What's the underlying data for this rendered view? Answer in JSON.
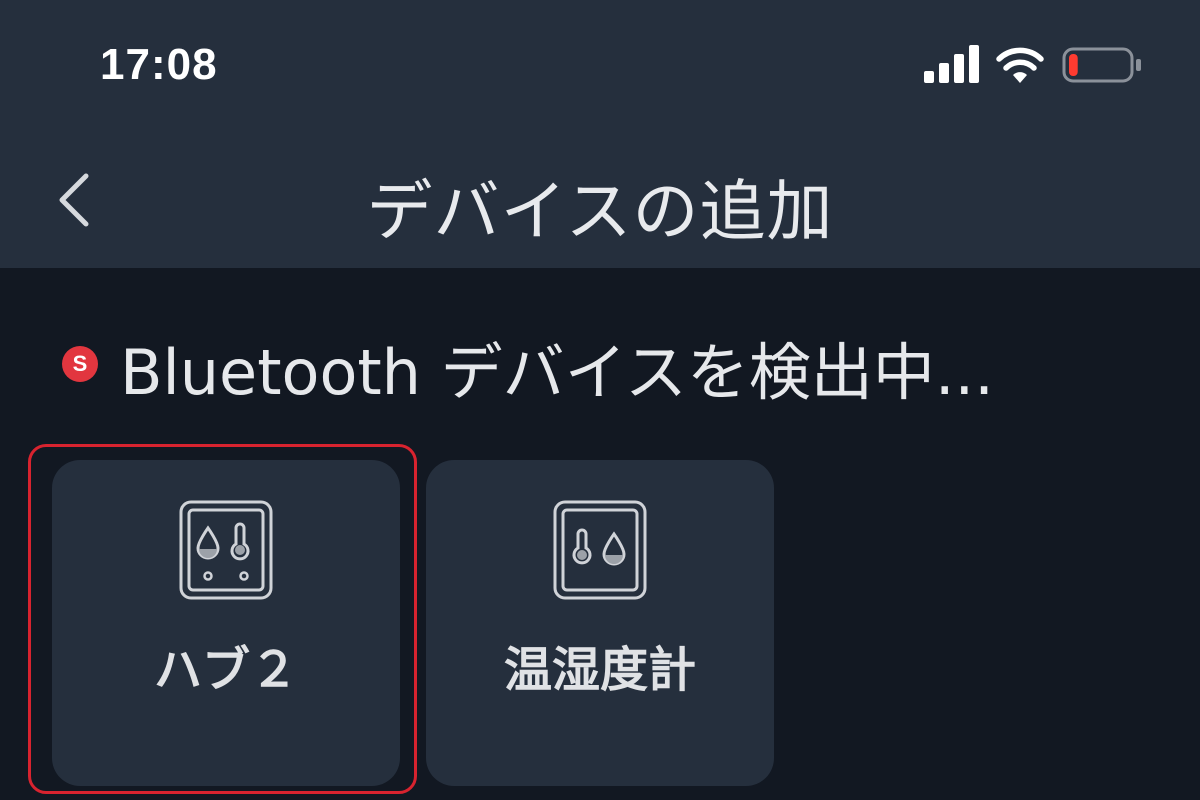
{
  "status_bar": {
    "time": "17:08",
    "icons": [
      "cellular-signal-icon",
      "wifi-icon",
      "battery-low-icon"
    ],
    "battery_level": 0.15
  },
  "nav": {
    "back_icon": "chevron-left-icon",
    "title": "デバイスの追加"
  },
  "scan": {
    "badge": "S",
    "badge_color": "#e2363f",
    "text": "Bluetooth デバイスを検出中..."
  },
  "devices": [
    {
      "label": "ハブ２",
      "icon": "hub2-device-icon",
      "highlighted": true
    },
    {
      "label": "温湿度計",
      "icon": "thermo-hygrometer-icon",
      "highlighted": false
    }
  ],
  "colors": {
    "header_bg": "#252f3d",
    "page_bg": "#121822",
    "card_bg": "#252f3d",
    "highlight": "#d8232f"
  }
}
